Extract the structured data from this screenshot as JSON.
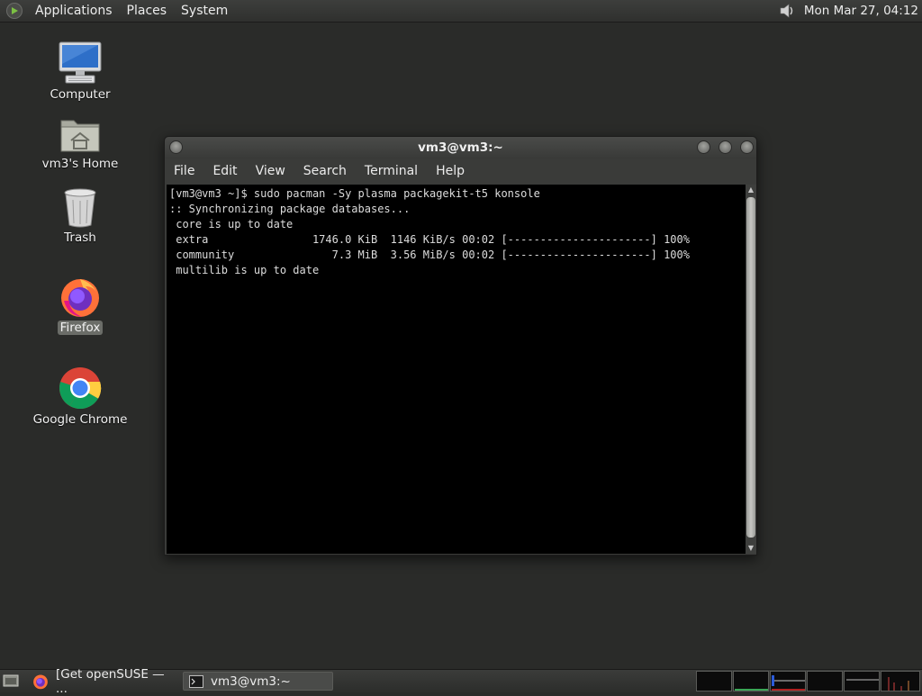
{
  "top_panel": {
    "menus": [
      "Applications",
      "Places",
      "System"
    ],
    "clock": "Mon Mar 27, 04:12"
  },
  "desktop": {
    "icons": [
      {
        "label": "Computer"
      },
      {
        "label": "vm3's Home"
      },
      {
        "label": "Trash"
      },
      {
        "label": "Firefox"
      },
      {
        "label": "Google Chrome"
      }
    ]
  },
  "terminal": {
    "title": "vm3@vm3:~",
    "menu": [
      "File",
      "Edit",
      "View",
      "Search",
      "Terminal",
      "Help"
    ],
    "lines": [
      "[vm3@vm3 ~]$ sudo pacman -Sy plasma packagekit-t5 konsole",
      ":: Synchronizing package databases...",
      " core is up to date",
      " extra                1746.0 KiB  1146 KiB/s 00:02 [----------------------] 100%",
      " community               7.3 MiB  3.56 MiB/s 00:02 [----------------------] 100%",
      " multilib is up to date"
    ]
  },
  "taskbar": {
    "tasks": [
      {
        "label": "[Get openSUSE — ...",
        "active": false
      },
      {
        "label": "vm3@vm3:~",
        "active": true
      }
    ]
  },
  "colors": {
    "desktop_bg": "#2a2b29",
    "terminal_bg": "#000000",
    "terminal_fg": "#dcdcdc"
  }
}
